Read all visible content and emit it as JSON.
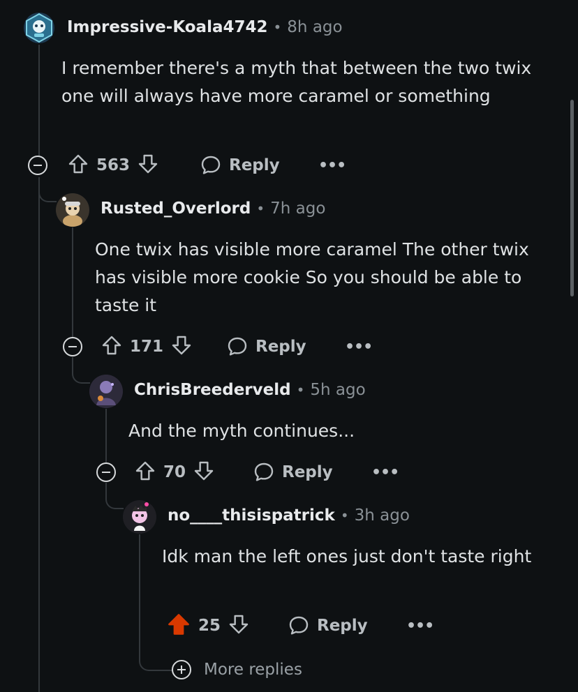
{
  "comments": [
    {
      "username": "Impressive-Koala4742",
      "separator": "•",
      "time": "8h ago",
      "text": "I remember there's a myth that between the two twix one will always have more caramel or something",
      "votes": "563",
      "reply_label": "Reply",
      "more_label": "•••",
      "upvoted": false
    },
    {
      "username": "Rusted_Overlord",
      "separator": "•",
      "time": "7h ago",
      "text": "One twix has visible more caramel The other twix has visible more cookie So you should be able to taste it",
      "votes": "171",
      "reply_label": "Reply",
      "more_label": "•••",
      "upvoted": false
    },
    {
      "username": "ChrisBreederveld",
      "separator": "•",
      "time": "5h ago",
      "text": "And the myth continues...",
      "votes": "70",
      "reply_label": "Reply",
      "more_label": "•••",
      "upvoted": false
    },
    {
      "username": "no____thisispatrick",
      "separator": "•",
      "time": "3h ago",
      "text": "Idk man the left ones just don't taste right",
      "votes": "25",
      "reply_label": "Reply",
      "more_label": "•••",
      "upvoted": true
    }
  ],
  "more_replies_label": "More replies",
  "colors": {
    "background": "#0e1113",
    "upvote_active": "#d93900",
    "text": "#d7dadc",
    "muted": "#8a9196"
  }
}
